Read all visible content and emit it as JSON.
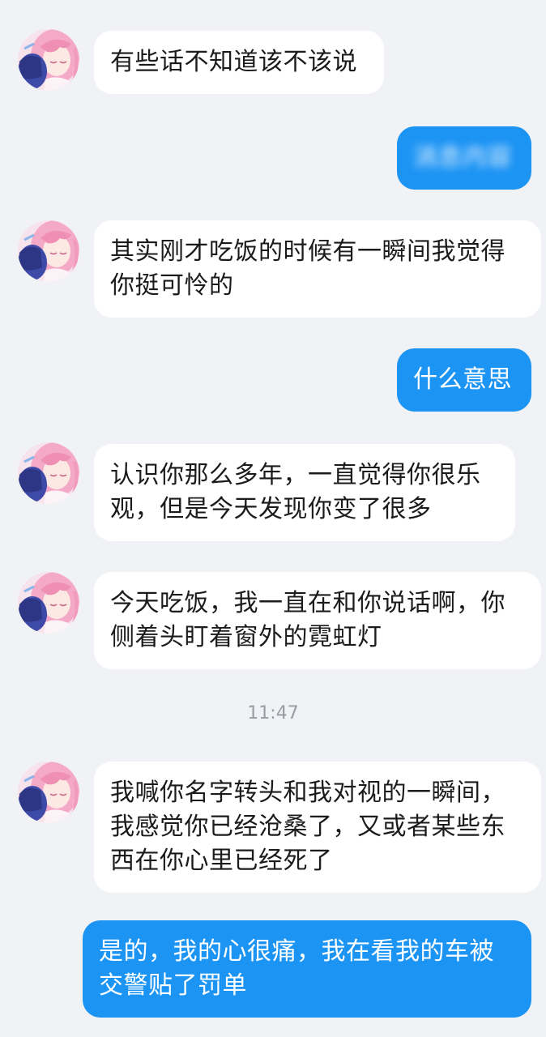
{
  "messages": [
    {
      "id": "m1",
      "side": "in",
      "text": "有些话不知道该不该说"
    },
    {
      "id": "m2",
      "side": "out",
      "text": "消息内容",
      "blurred": true
    },
    {
      "id": "m3",
      "side": "in",
      "text": "其实刚才吃饭的时候有一瞬间我觉得你挺可怜的"
    },
    {
      "id": "m4",
      "side": "out",
      "text": "什么意思"
    },
    {
      "id": "m5",
      "side": "in",
      "text": "认识你那么多年，一直觉得你很乐观，但是今天发现你变了很多"
    },
    {
      "id": "m6",
      "side": "in",
      "text": "今天吃饭，我一直在和你说话啊，你侧着头盯着窗外的霓虹灯"
    },
    {
      "id": "m7",
      "side": "in",
      "text": "我喊你名字转头和我对视的一瞬间，我感觉你已经沧桑了，又或者某些东西在你心里已经死了"
    },
    {
      "id": "m8",
      "side": "out",
      "text": "是的，我的心很痛，我在看我的车被交警贴了罚单"
    }
  ],
  "timestamp": "11:47",
  "colors": {
    "background": "#f1f2f6",
    "incoming_bubble": "#ffffff",
    "outgoing_bubble": "#1c94f4",
    "timestamp_text": "#9a9ca4"
  },
  "icons": {
    "contact_avatar": "anime-avatar-icon"
  }
}
